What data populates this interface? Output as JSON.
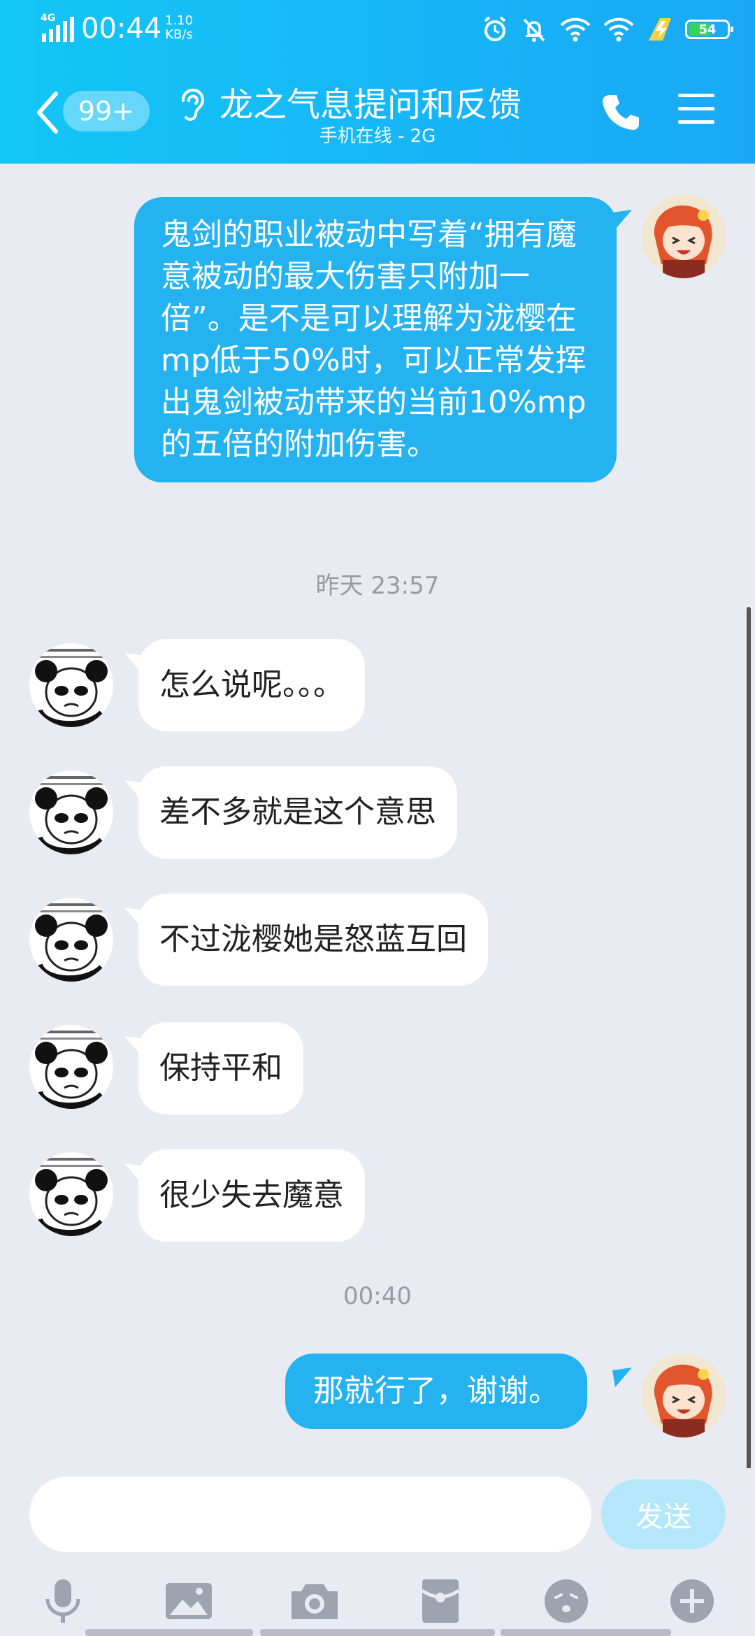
{
  "status_bar": {
    "network": "4G",
    "time": "00:44",
    "speed_value": "1.10",
    "speed_unit": "KB/s",
    "battery": "54"
  },
  "header": {
    "unread_badge": "99+",
    "title": "龙之气息提问和反馈",
    "subtitle": "手机在线 - 2G"
  },
  "messages": [
    {
      "side": "out",
      "text": "鬼剑的职业被动中写着“拥有魔意被动的最大伤害只附加一倍”。是不是可以理解为泷樱在mp低于50%时，可以正常发挥出鬼剑被动带来的当前10%mp的五倍的附加伤害。"
    },
    {
      "type": "timestamp",
      "text": "昨天 23:57"
    },
    {
      "side": "in",
      "text": "怎么说呢。。。"
    },
    {
      "side": "in",
      "text": "差不多就是这个意思"
    },
    {
      "side": "in",
      "text": "不过泷樱她是怒蓝互回"
    },
    {
      "side": "in",
      "text": "保持平和"
    },
    {
      "side": "in",
      "text": "很少失去魔意"
    },
    {
      "type": "timestamp",
      "text": "00:40"
    },
    {
      "side": "out",
      "text": "那就行了，谢谢。"
    }
  ],
  "input": {
    "value": "",
    "send_label": "发送"
  },
  "colors": {
    "header_start": "#14c6f6",
    "header_end": "#1aa8f6",
    "outgoing_bubble": "#25b2f1",
    "incoming_bubble": "#ffffff",
    "chat_background": "#e9ebf2",
    "send_button": "#b5e7fb"
  },
  "icons": {
    "back": "chevron-left-icon",
    "ear": "ear-icon",
    "call": "phone-icon",
    "menu": "menu-icon",
    "toolbar": [
      "microphone-icon",
      "image-icon",
      "camera-icon",
      "red-packet-icon",
      "emoji-icon",
      "plus-icon"
    ]
  }
}
